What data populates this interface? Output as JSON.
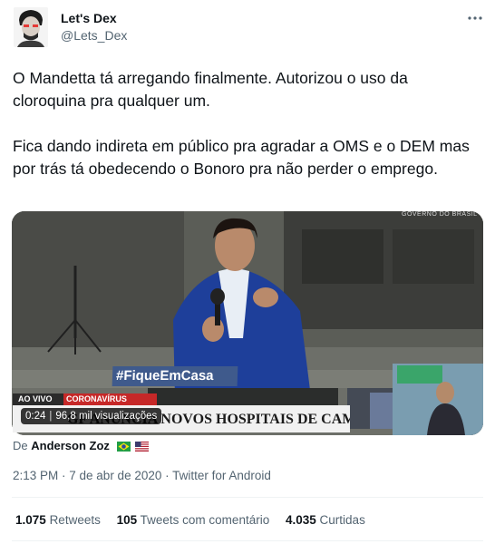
{
  "author": {
    "name": "Let's Dex",
    "handle": "@Lets_Dex"
  },
  "tweet": {
    "paragraph1": "O Mandetta tá arregando finalmente. Autorizou o uso da cloroquina pra qualquer um.",
    "paragraph2": "Fica dando indireta em público pra agradar a OMS e o DEM mas por trás tá obedecendo o Bonoro pra não perder o emprego."
  },
  "media": {
    "overlay_hashtag": "#FiqueEmCasa",
    "overlay_live": "AO VIVO",
    "overlay_topic": "CORONAVÍRUS",
    "overlay_headline": "GF ANUNCIA NOVOS HOSPITAIS DE CAM",
    "duration": "0:24",
    "views": "96,8 mil visualizações"
  },
  "attribution": {
    "prefix": "De",
    "source_name": "Anderson Zoz",
    "flags": [
      "brazil-flag-icon",
      "usa-flag-icon"
    ]
  },
  "meta": {
    "time": "2:13 PM",
    "date": "7 de abr de 2020",
    "client": "Twitter for Android",
    "line": "2:13 PM · 7 de abr de 2020 · Twitter for Android"
  },
  "counts": {
    "retweets_num": "1.075",
    "retweets_label": "Retweets",
    "comments_num": "105",
    "comments_label": "Tweets com comentário",
    "likes_num": "4.035",
    "likes_label": "Curtidas"
  },
  "colors": {
    "text": "#0f1419",
    "secondary": "#536471",
    "divider": "#eff3f4",
    "hashtag_bg": "#3f5a8c",
    "corona_bg": "#c62828"
  }
}
